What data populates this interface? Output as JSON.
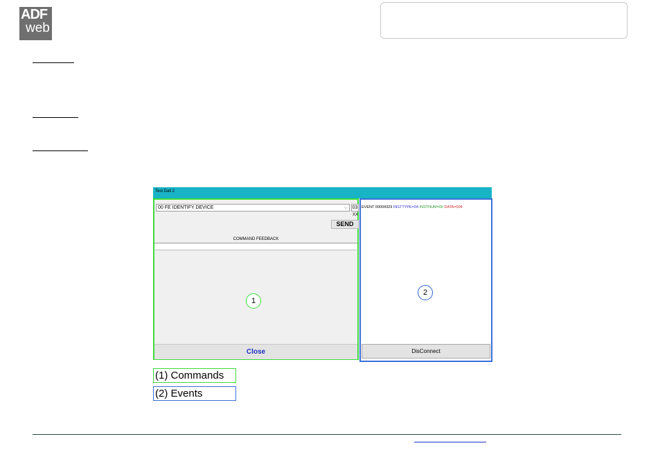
{
  "logo": {
    "line1": "ADF",
    "line2": "web"
  },
  "app": {
    "title": "Test Dali 2",
    "command_select": "00 FE IDENTIFY DEVICE",
    "command_arrow": "⌵",
    "number_value": "03",
    "number_hint": "XX",
    "send_label": "SEND",
    "feedback_label": "COMMAND FEEDBACK",
    "close_label": "Close",
    "disconnect_label": "DisConnect",
    "event": {
      "prefix": "EVENT",
      "id": "00004329",
      "insttype": "INSTTYPE=04",
      "instnum": "INSTNUM=00",
      "data": "DATA=004"
    },
    "marker_commands": "1",
    "marker_events": "2"
  },
  "legend": {
    "commands": "(1) Commands",
    "events": "(2) Events"
  },
  "colors": {
    "commands_border": "#3cdc3c",
    "events_border": "#3a6fd8",
    "titlebar": "#19b3c6"
  }
}
